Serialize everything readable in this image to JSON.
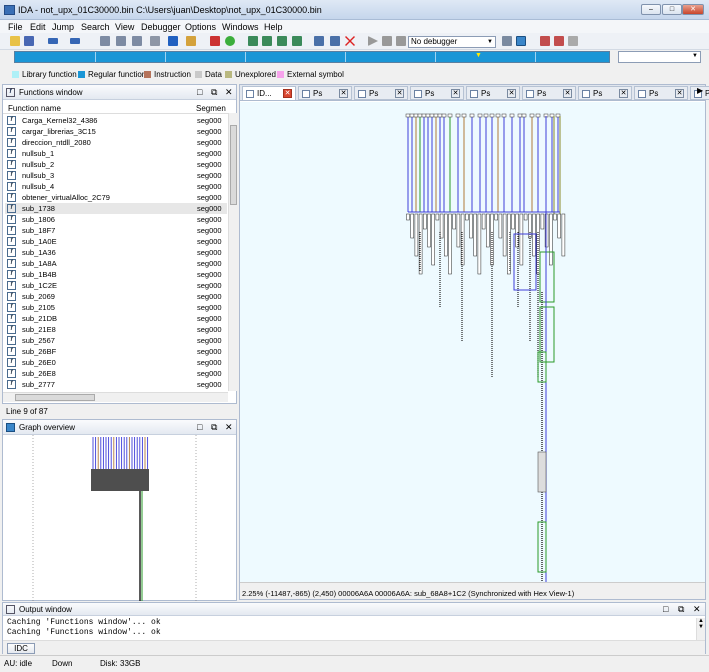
{
  "window": {
    "title": "IDA - not_upx_01C30000.bin C:\\Users\\juan\\Desktop\\not_upx_01C30000.bin",
    "min": "‒",
    "max": "□",
    "close": "✕"
  },
  "menu": [
    "File",
    "Edit",
    "Jump",
    "Search",
    "View",
    "Debugger",
    "Options",
    "Windows",
    "Help"
  ],
  "toolbar": {
    "debugger_select": "No debugger"
  },
  "legend": [
    {
      "label": "Library function",
      "color": "#aef0f7"
    },
    {
      "label": "Regular function",
      "color": "#1a96d6"
    },
    {
      "label": "Instruction",
      "color": "#b5735a"
    },
    {
      "label": "Data",
      "color": "#c9c9c9"
    },
    {
      "label": "Unexplored",
      "color": "#b9b87f"
    },
    {
      "label": "External symbol",
      "color": "#f7a3ec"
    }
  ],
  "functions_window": {
    "title": "Functions window",
    "col_name": "Function name",
    "col_segment": "Segmen",
    "rows": [
      {
        "name": "Carga_Kernel32_4386",
        "segment": "seg000"
      },
      {
        "name": "cargar_librerias_3C15",
        "segment": "seg000"
      },
      {
        "name": "direccion_ntdll_2080",
        "segment": "seg000"
      },
      {
        "name": "nullsub_1",
        "segment": "seg000"
      },
      {
        "name": "nullsub_2",
        "segment": "seg000"
      },
      {
        "name": "nullsub_3",
        "segment": "seg000"
      },
      {
        "name": "nullsub_4",
        "segment": "seg000"
      },
      {
        "name": "obtener_virtualAlloc_2C79",
        "segment": "seg000"
      },
      {
        "name": "sub_1738",
        "segment": "seg000"
      },
      {
        "name": "sub_1806",
        "segment": "seg000"
      },
      {
        "name": "sub_18F7",
        "segment": "seg000"
      },
      {
        "name": "sub_1A0E",
        "segment": "seg000"
      },
      {
        "name": "sub_1A36",
        "segment": "seg000"
      },
      {
        "name": "sub_1A8A",
        "segment": "seg000"
      },
      {
        "name": "sub_1B4B",
        "segment": "seg000"
      },
      {
        "name": "sub_1C2E",
        "segment": "seg000"
      },
      {
        "name": "sub_2069",
        "segment": "seg000"
      },
      {
        "name": "sub_2105",
        "segment": "seg000"
      },
      {
        "name": "sub_21DB",
        "segment": "seg000"
      },
      {
        "name": "sub_21E8",
        "segment": "seg000"
      },
      {
        "name": "sub_2567",
        "segment": "seg000"
      },
      {
        "name": "sub_26BF",
        "segment": "seg000"
      },
      {
        "name": "sub_26E0",
        "segment": "seg000"
      },
      {
        "name": "sub_26E8",
        "segment": "seg000"
      },
      {
        "name": "sub_2777",
        "segment": "seg000"
      }
    ],
    "selected_index": 8,
    "line_count": "Line 9 of 87"
  },
  "graph_overview": {
    "title": "Graph overview"
  },
  "tabs": [
    "ID...",
    "Ps",
    "Ps",
    "Ps",
    "Ps",
    "Ps",
    "Ps",
    "Ps",
    "Ps"
  ],
  "graph_status": "2.25%  (-11487,-865)  (2,450)  00006A6A  00006A6A: sub_68A8+1C2  (Synchronized with Hex View-1)",
  "output_window": {
    "title": "Output window",
    "lines": [
      "Caching 'Functions window'... ok",
      "Caching 'Functions window'... ok"
    ],
    "idc_button": "IDC"
  },
  "statusbar": {
    "au": "AU:  idle",
    "direction": "Down",
    "disk": "Disk: 33GB"
  }
}
